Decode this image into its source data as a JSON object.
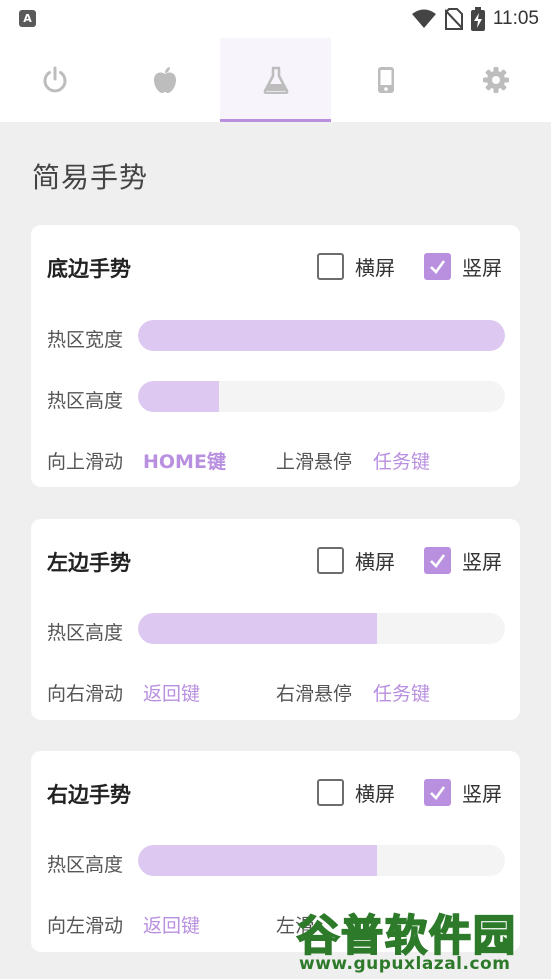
{
  "status_bar": {
    "app_icon_letter": "A",
    "time": "11:05"
  },
  "tabs": [
    {
      "icon": "power-icon",
      "active": false
    },
    {
      "icon": "apple-icon",
      "active": false
    },
    {
      "icon": "flask-icon",
      "active": true
    },
    {
      "icon": "phone-icon",
      "active": false
    },
    {
      "icon": "gear-icon",
      "active": false
    }
  ],
  "page": {
    "title": "简易手势"
  },
  "cards": {
    "bottom": {
      "title": "底边手势",
      "landscape_label": "横屏",
      "landscape_checked": false,
      "portrait_label": "竖屏",
      "portrait_checked": true,
      "width_label": "热区宽度",
      "width_value": 1.0,
      "height_label": "热区高度",
      "height_value": 0.22,
      "swipe_label": "向上滑动",
      "swipe_value": "HOME键",
      "hover_label": "上滑悬停",
      "hover_value": "任务键"
    },
    "left": {
      "title": "左边手势",
      "landscape_label": "横屏",
      "landscape_checked": false,
      "portrait_label": "竖屏",
      "portrait_checked": true,
      "height_label": "热区高度",
      "height_value": 0.65,
      "swipe_label": "向右滑动",
      "swipe_value": "返回键",
      "hover_label": "右滑悬停",
      "hover_value": "任务键"
    },
    "right": {
      "title": "右边手势",
      "landscape_label": "横屏",
      "landscape_checked": false,
      "portrait_label": "竖屏",
      "portrait_checked": true,
      "height_label": "热区高度",
      "height_value": 0.65,
      "swipe_label": "向左滑动",
      "swipe_value": "返回键",
      "hover_label": "左滑"
    }
  },
  "watermark": {
    "text": "谷普软件园",
    "url": "www.gupuxlazal.com"
  },
  "colors": {
    "accent": "#b98fe0",
    "slider_fill": "#ddc8f1",
    "background": "#efefef"
  }
}
